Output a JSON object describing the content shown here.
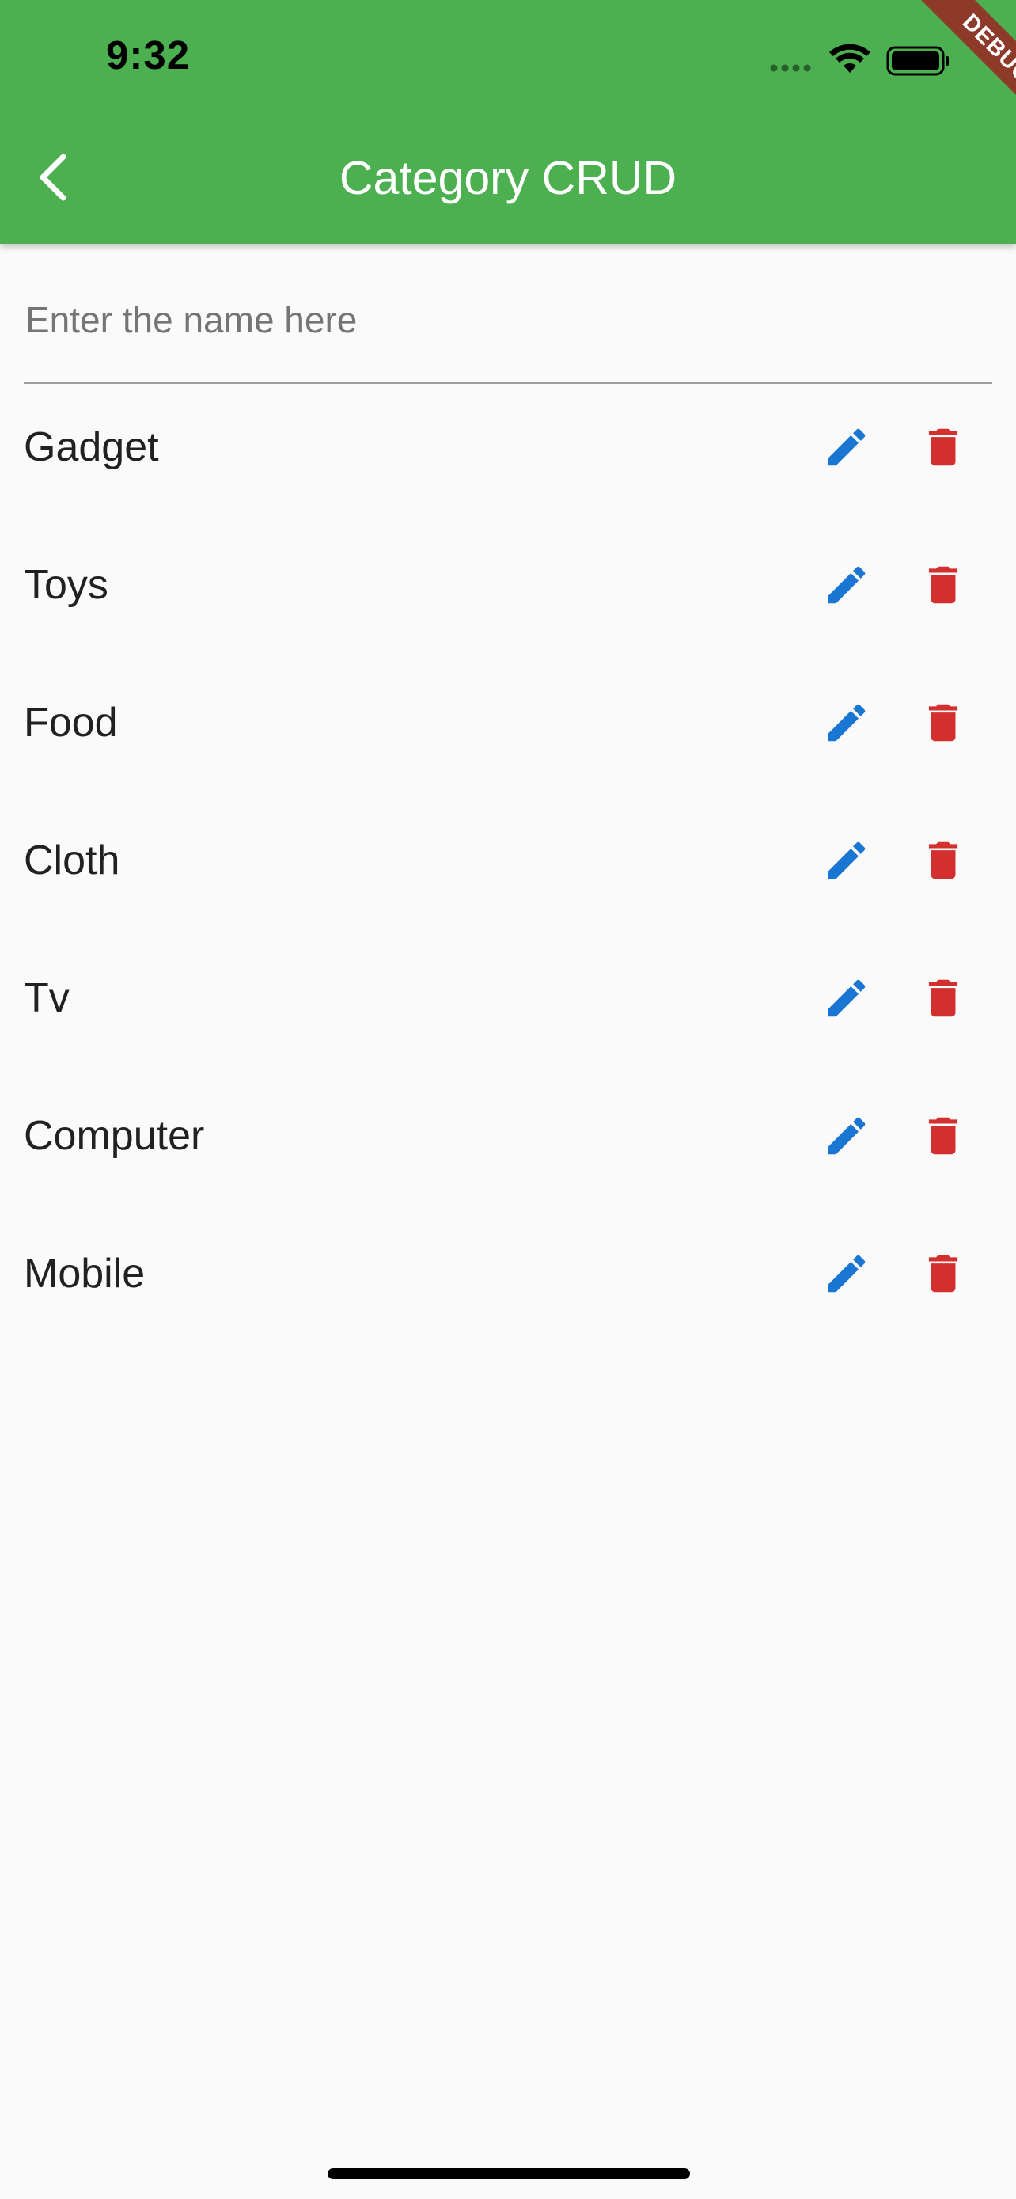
{
  "status_bar": {
    "time": "9:32"
  },
  "app_bar": {
    "title": "Category CRUD",
    "color": "#4caf50"
  },
  "debug_banner": {
    "label": "DEBUG"
  },
  "input": {
    "placeholder": "Enter the name here",
    "value": ""
  },
  "categories": [
    {
      "name": "Gadget"
    },
    {
      "name": "Toys"
    },
    {
      "name": "Food"
    },
    {
      "name": "Cloth"
    },
    {
      "name": "Tv"
    },
    {
      "name": "Computer"
    },
    {
      "name": "Mobile"
    }
  ],
  "icons": {
    "edit": "pencil-icon",
    "delete": "trash-icon",
    "back": "chevron-left-icon"
  },
  "colors": {
    "edit": "#1976d2",
    "delete": "#d32f2f"
  }
}
